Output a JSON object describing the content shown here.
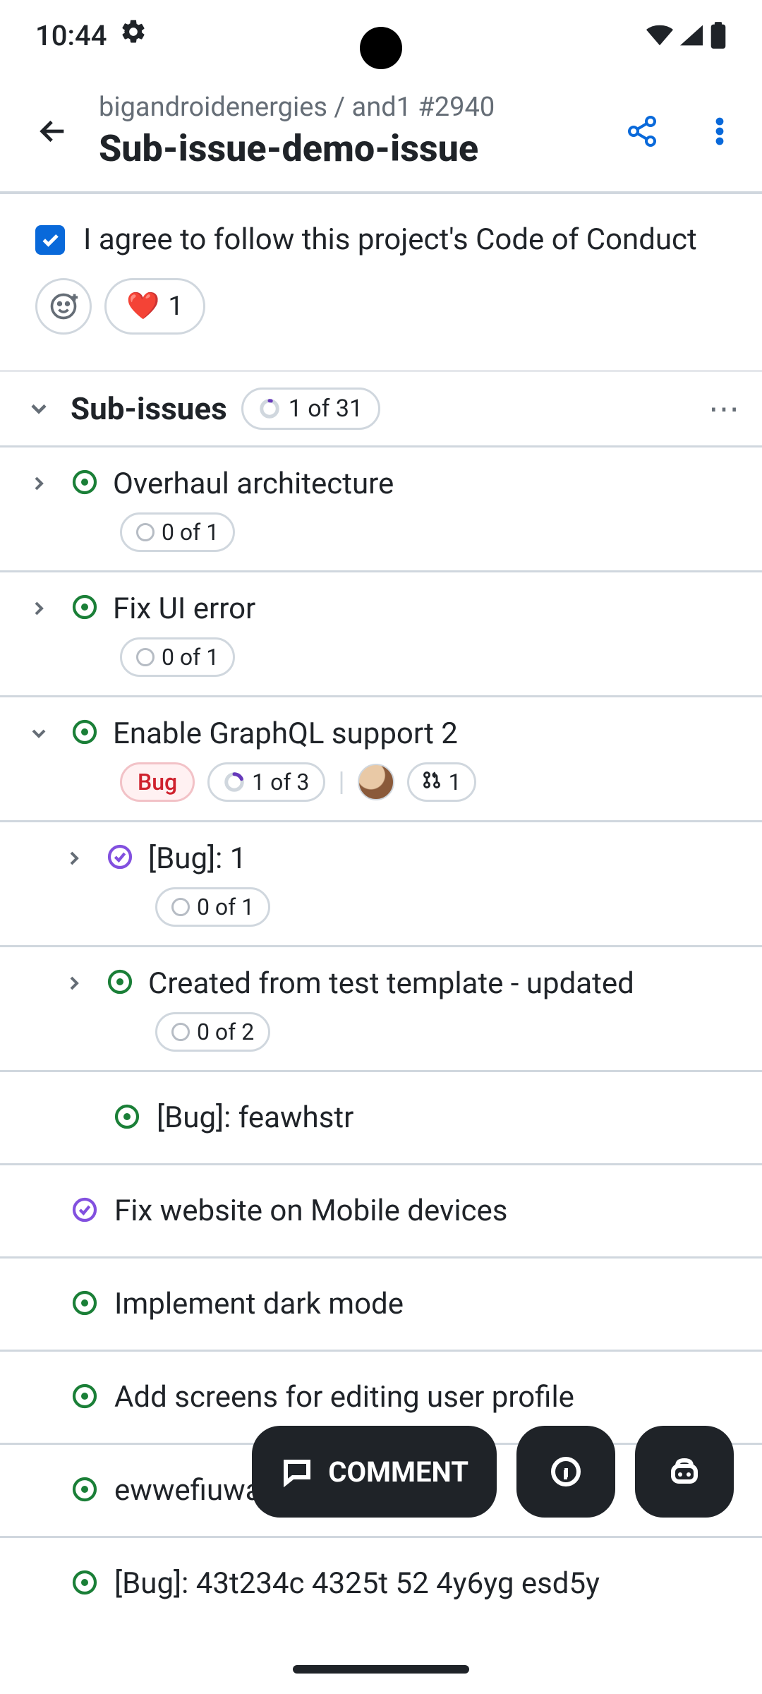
{
  "status_bar": {
    "time": "10:44"
  },
  "header": {
    "breadcrumb": "bigandroidenergies / and1 #2940",
    "title": "Sub-issue-demo-issue"
  },
  "coc_text": "I agree to follow this project's Code of Conduct",
  "reaction_heart_count": "1",
  "sub_issues_label": "Sub-issues",
  "sub_issues_progress": "1 of 31",
  "issues": {
    "overhaul": {
      "title": "Overhaul architecture",
      "progress": "0 of 1"
    },
    "fixui": {
      "title": "Fix UI error",
      "progress": "0 of 1"
    },
    "graphql": {
      "title": "Enable GraphQL support 2",
      "label": "Bug",
      "progress": "1 of 3",
      "pr_count": "1"
    },
    "bug1": {
      "title": "[Bug]: 1",
      "progress": "0 of 1"
    },
    "template": {
      "title": "Created from test template - updated",
      "progress": "0 of 2"
    },
    "feawhstr": {
      "title": "[Bug]: feawhstr"
    },
    "mobile": {
      "title": "Fix website on Mobile devices"
    },
    "dark": {
      "title": "Implement dark mode"
    },
    "profile": {
      "title": "Add screens for editing user profile"
    },
    "eww": {
      "title": "ewwefiuwaf"
    },
    "last": {
      "title": "[Bug]: 43t234c 4325t 52 4y6yg esd5y"
    }
  },
  "comment_label": "COMMENT"
}
